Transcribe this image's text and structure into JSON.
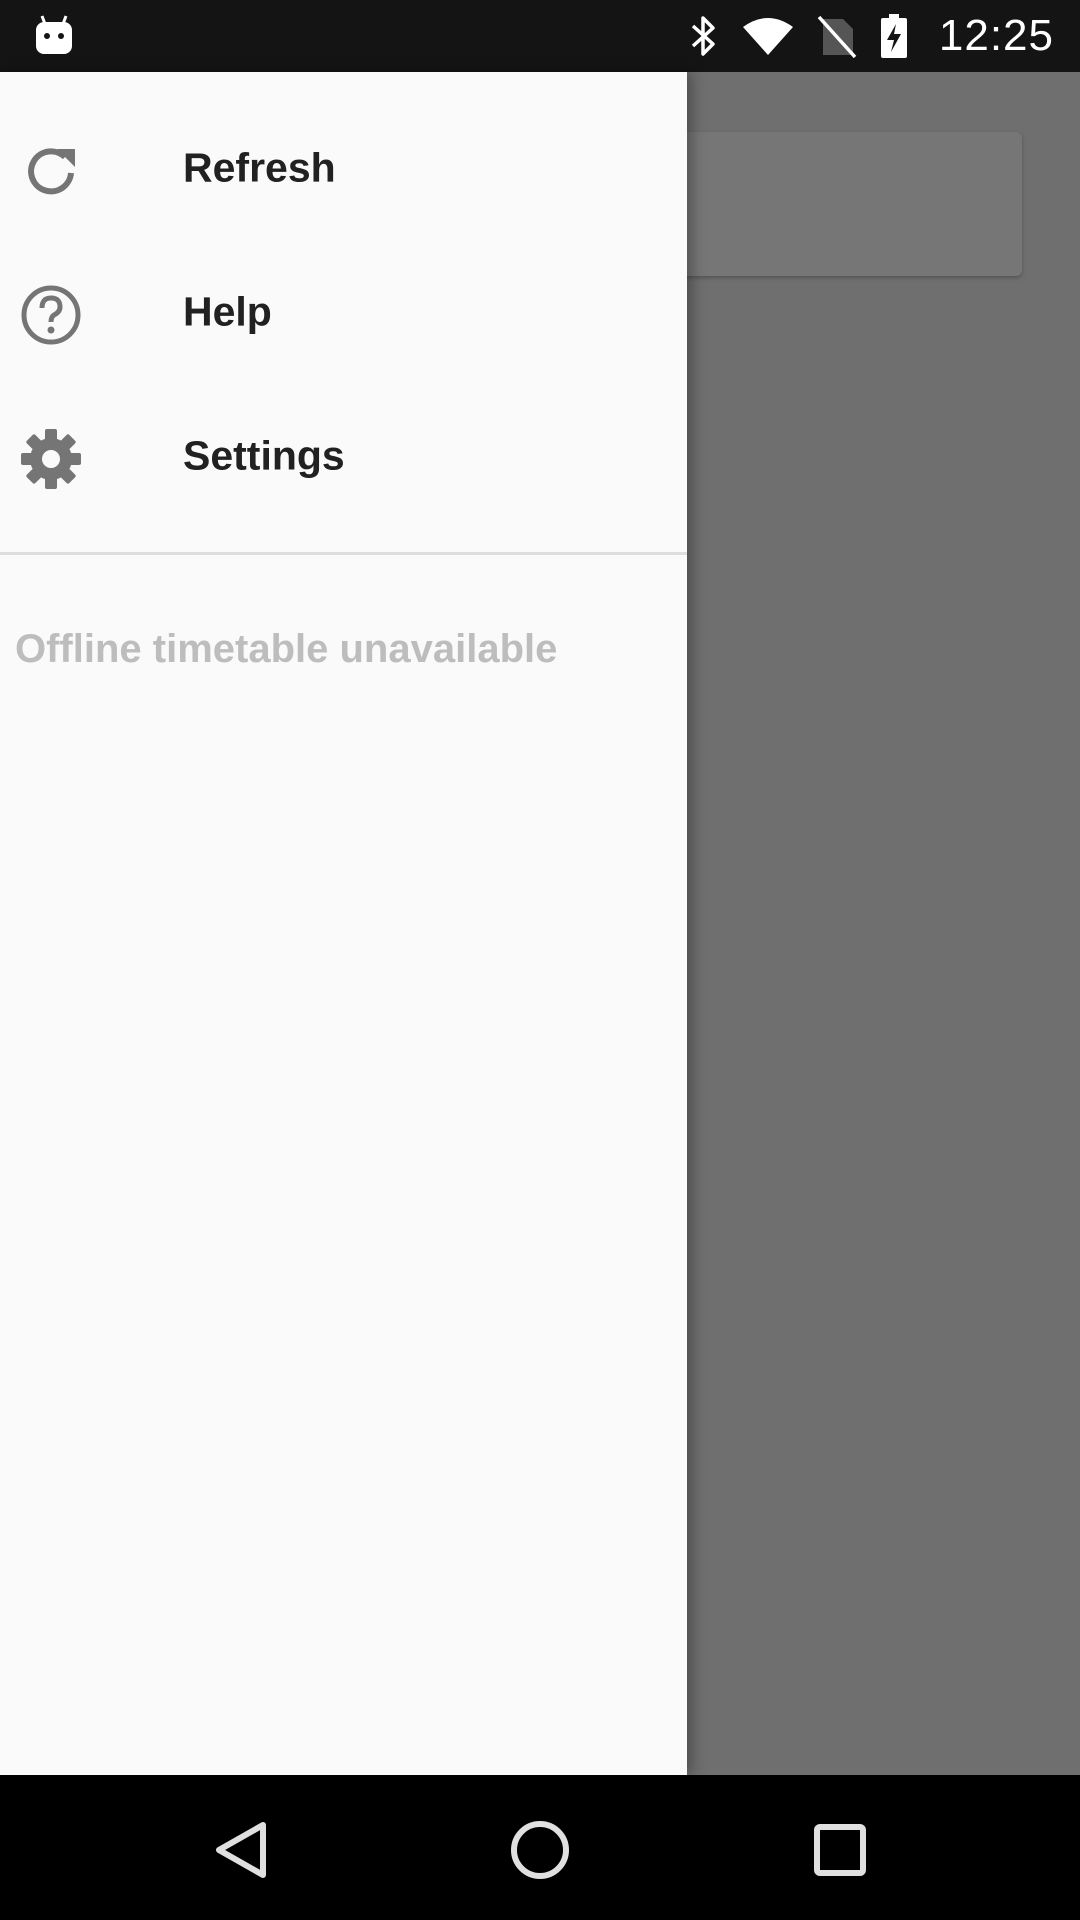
{
  "status_bar": {
    "time": "12:25",
    "icons": [
      "android-notification-icon",
      "bluetooth-icon",
      "wifi-icon",
      "no-sim-icon",
      "battery-charging-icon"
    ]
  },
  "drawer": {
    "items": [
      {
        "label": "Refresh",
        "icon": "refresh-icon"
      },
      {
        "label": "Help",
        "icon": "help-icon"
      },
      {
        "label": "Settings",
        "icon": "settings-icon"
      }
    ],
    "status_text": "Offline timetable unavailable"
  },
  "nav_bar": {
    "buttons": [
      "back-icon",
      "home-icon",
      "recents-icon"
    ]
  },
  "colors": {
    "drawer_background": "#fafafa",
    "scrim": "#6f6f6f",
    "icon": "#757575",
    "label": "#212121",
    "disabled_text": "#bdbdbd"
  }
}
